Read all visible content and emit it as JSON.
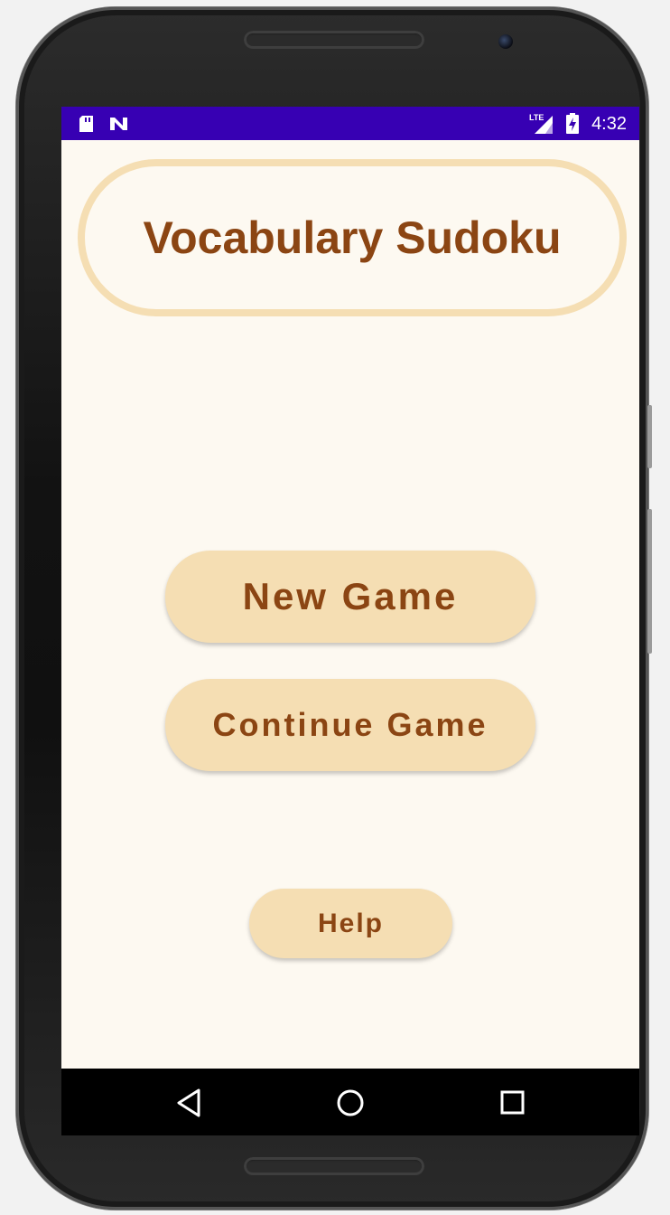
{
  "status_bar": {
    "time": "4:32",
    "left_icons": [
      "sd-card-icon",
      "n-notification-icon"
    ],
    "right_icons": [
      "lte-signal-icon",
      "battery-charging-icon"
    ],
    "network_label": "LTE",
    "color": "#3700b3"
  },
  "app": {
    "title": "Vocabulary Sudoku",
    "buttons": {
      "new_game": "New Game",
      "continue_game": "Continue Game",
      "help": "Help"
    },
    "colors": {
      "background": "#fdf9f1",
      "button_fill": "#f5deb3",
      "text": "#8b4513"
    }
  },
  "nav_bar": {
    "icons": [
      "back-icon",
      "home-icon",
      "recents-icon"
    ]
  }
}
